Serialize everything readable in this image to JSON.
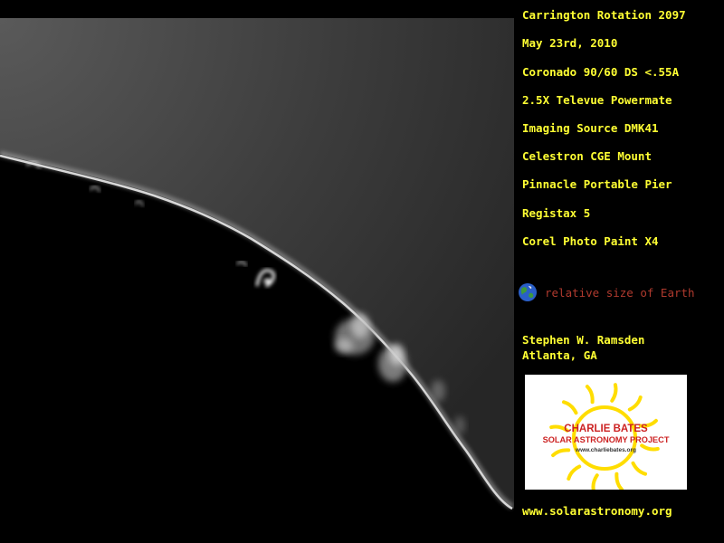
{
  "info": {
    "lines": [
      "Carrington Rotation 2097",
      "May 23rd, 2010",
      "Coronado 90/60 DS <.55A",
      "2.5X Televue Powermate",
      "Imaging Source DMK41",
      "Celestron CGE Mount",
      "Pinnacle Portable Pier",
      "Registax 5",
      "Corel Photo Paint X4"
    ],
    "earth_label": "relative size of Earth",
    "author": "Stephen W. Ramsden",
    "location": "Atlanta, GA",
    "website": "www.solarastronomy.org"
  },
  "logo": {
    "line1": "CHARLIE BATES",
    "line2": "SOLAR ASTRONOMY PROJECT",
    "url": "www.charliebates.org"
  },
  "colors": {
    "info_text": "#ffff33",
    "earth_label": "#b03a2e",
    "logo_text": "#cc2222",
    "logo_sun": "#ffdd00",
    "background": "#000000"
  }
}
